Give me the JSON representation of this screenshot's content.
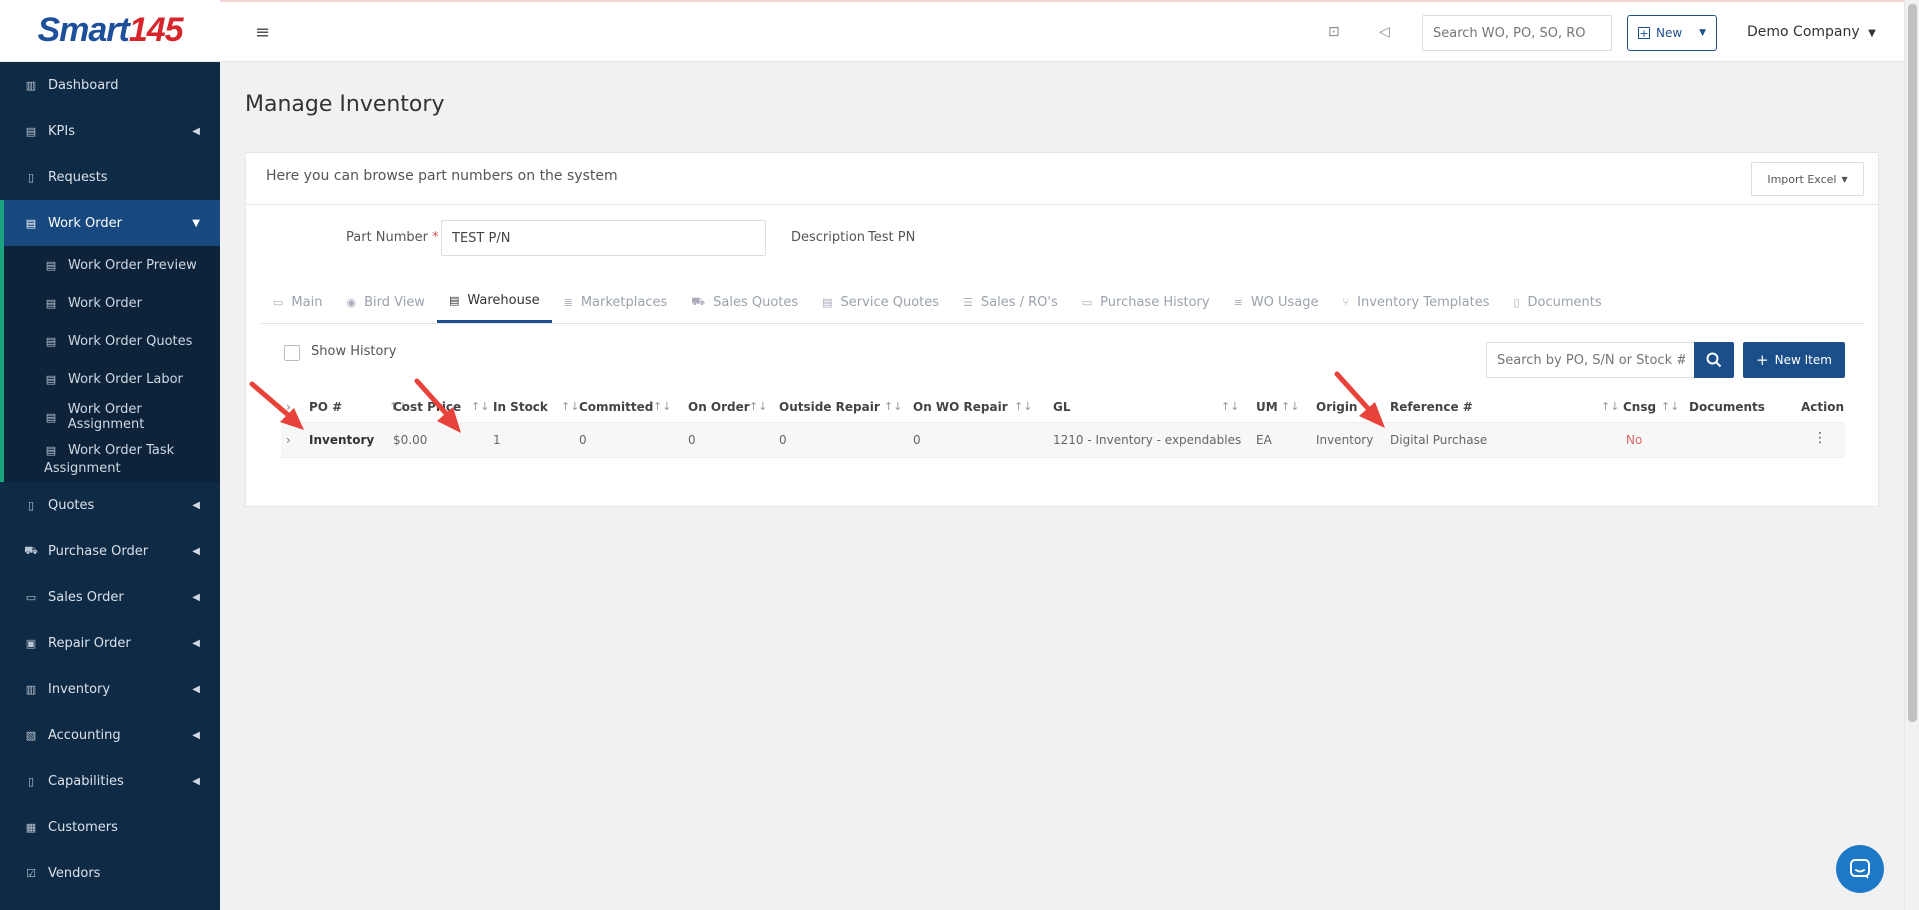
{
  "brand": {
    "word": "Smart",
    "num": "145"
  },
  "sidebar": {
    "items": [
      {
        "label": "Dashboard"
      },
      {
        "label": "KPIs"
      },
      {
        "label": "Requests"
      },
      {
        "label": "Work Order"
      },
      {
        "label": "Quotes"
      },
      {
        "label": "Purchase Order"
      },
      {
        "label": "Sales Order"
      },
      {
        "label": "Repair Order"
      },
      {
        "label": "Inventory"
      },
      {
        "label": "Accounting"
      },
      {
        "label": "Capabilities"
      },
      {
        "label": "Customers"
      },
      {
        "label": "Vendors"
      }
    ],
    "work_order_sub": [
      {
        "label": "Work Order Preview"
      },
      {
        "label": "Work Order"
      },
      {
        "label": "Work Order Quotes"
      },
      {
        "label": "Work Order Labor"
      },
      {
        "label": "Work Order Assignment"
      },
      {
        "label": "Work Order Task Assignment"
      }
    ]
  },
  "topbar": {
    "search_placeholder": "Search WO, PO, SO, RO",
    "new_label": "New",
    "company": "Demo Company"
  },
  "page": {
    "title": "Manage Inventory",
    "card_desc": "Here you can browse part numbers on the system",
    "import_label": "Import Excel",
    "part_number_label": "Part Number",
    "part_number_value": "TEST P/N",
    "description_label": "Description",
    "description_value": "Test PN"
  },
  "tabs": [
    {
      "label": "Main"
    },
    {
      "label": "Bird View"
    },
    {
      "label": "Warehouse"
    },
    {
      "label": "Marketplaces"
    },
    {
      "label": "Sales Quotes"
    },
    {
      "label": "Service Quotes"
    },
    {
      "label": "Sales / RO's"
    },
    {
      "label": "Purchase History"
    },
    {
      "label": "WO Usage"
    },
    {
      "label": "Inventory Templates"
    },
    {
      "label": "Documents"
    }
  ],
  "table": {
    "show_history": "Show History",
    "search_placeholder": "Search by PO, S/N or Stock #",
    "new_item": "New Item",
    "columns": [
      "PO #",
      "Cost Price",
      "In Stock",
      "Committed",
      "On Order",
      "Outside Repair",
      "On WO Repair",
      "GL",
      "UM",
      "Origin",
      "Reference #",
      "Cnsg",
      "Documents",
      "Action"
    ],
    "rows": [
      {
        "po": "Inventory",
        "cost": "$0.00",
        "in_stock": "1",
        "committed": "0",
        "on_order": "0",
        "outside_repair": "0",
        "on_wo_repair": "0",
        "gl": "1210 - Inventory - expendables",
        "um": "EA",
        "origin": "Inventory",
        "reference": "Digital Purchase",
        "cnsg": "No",
        "documents": ""
      }
    ]
  },
  "colors": {
    "sidebar_bg": "#0f2a44",
    "accent": "#1b4f8a",
    "active_border": "#1aa37f",
    "arrow": "#e8423a"
  }
}
